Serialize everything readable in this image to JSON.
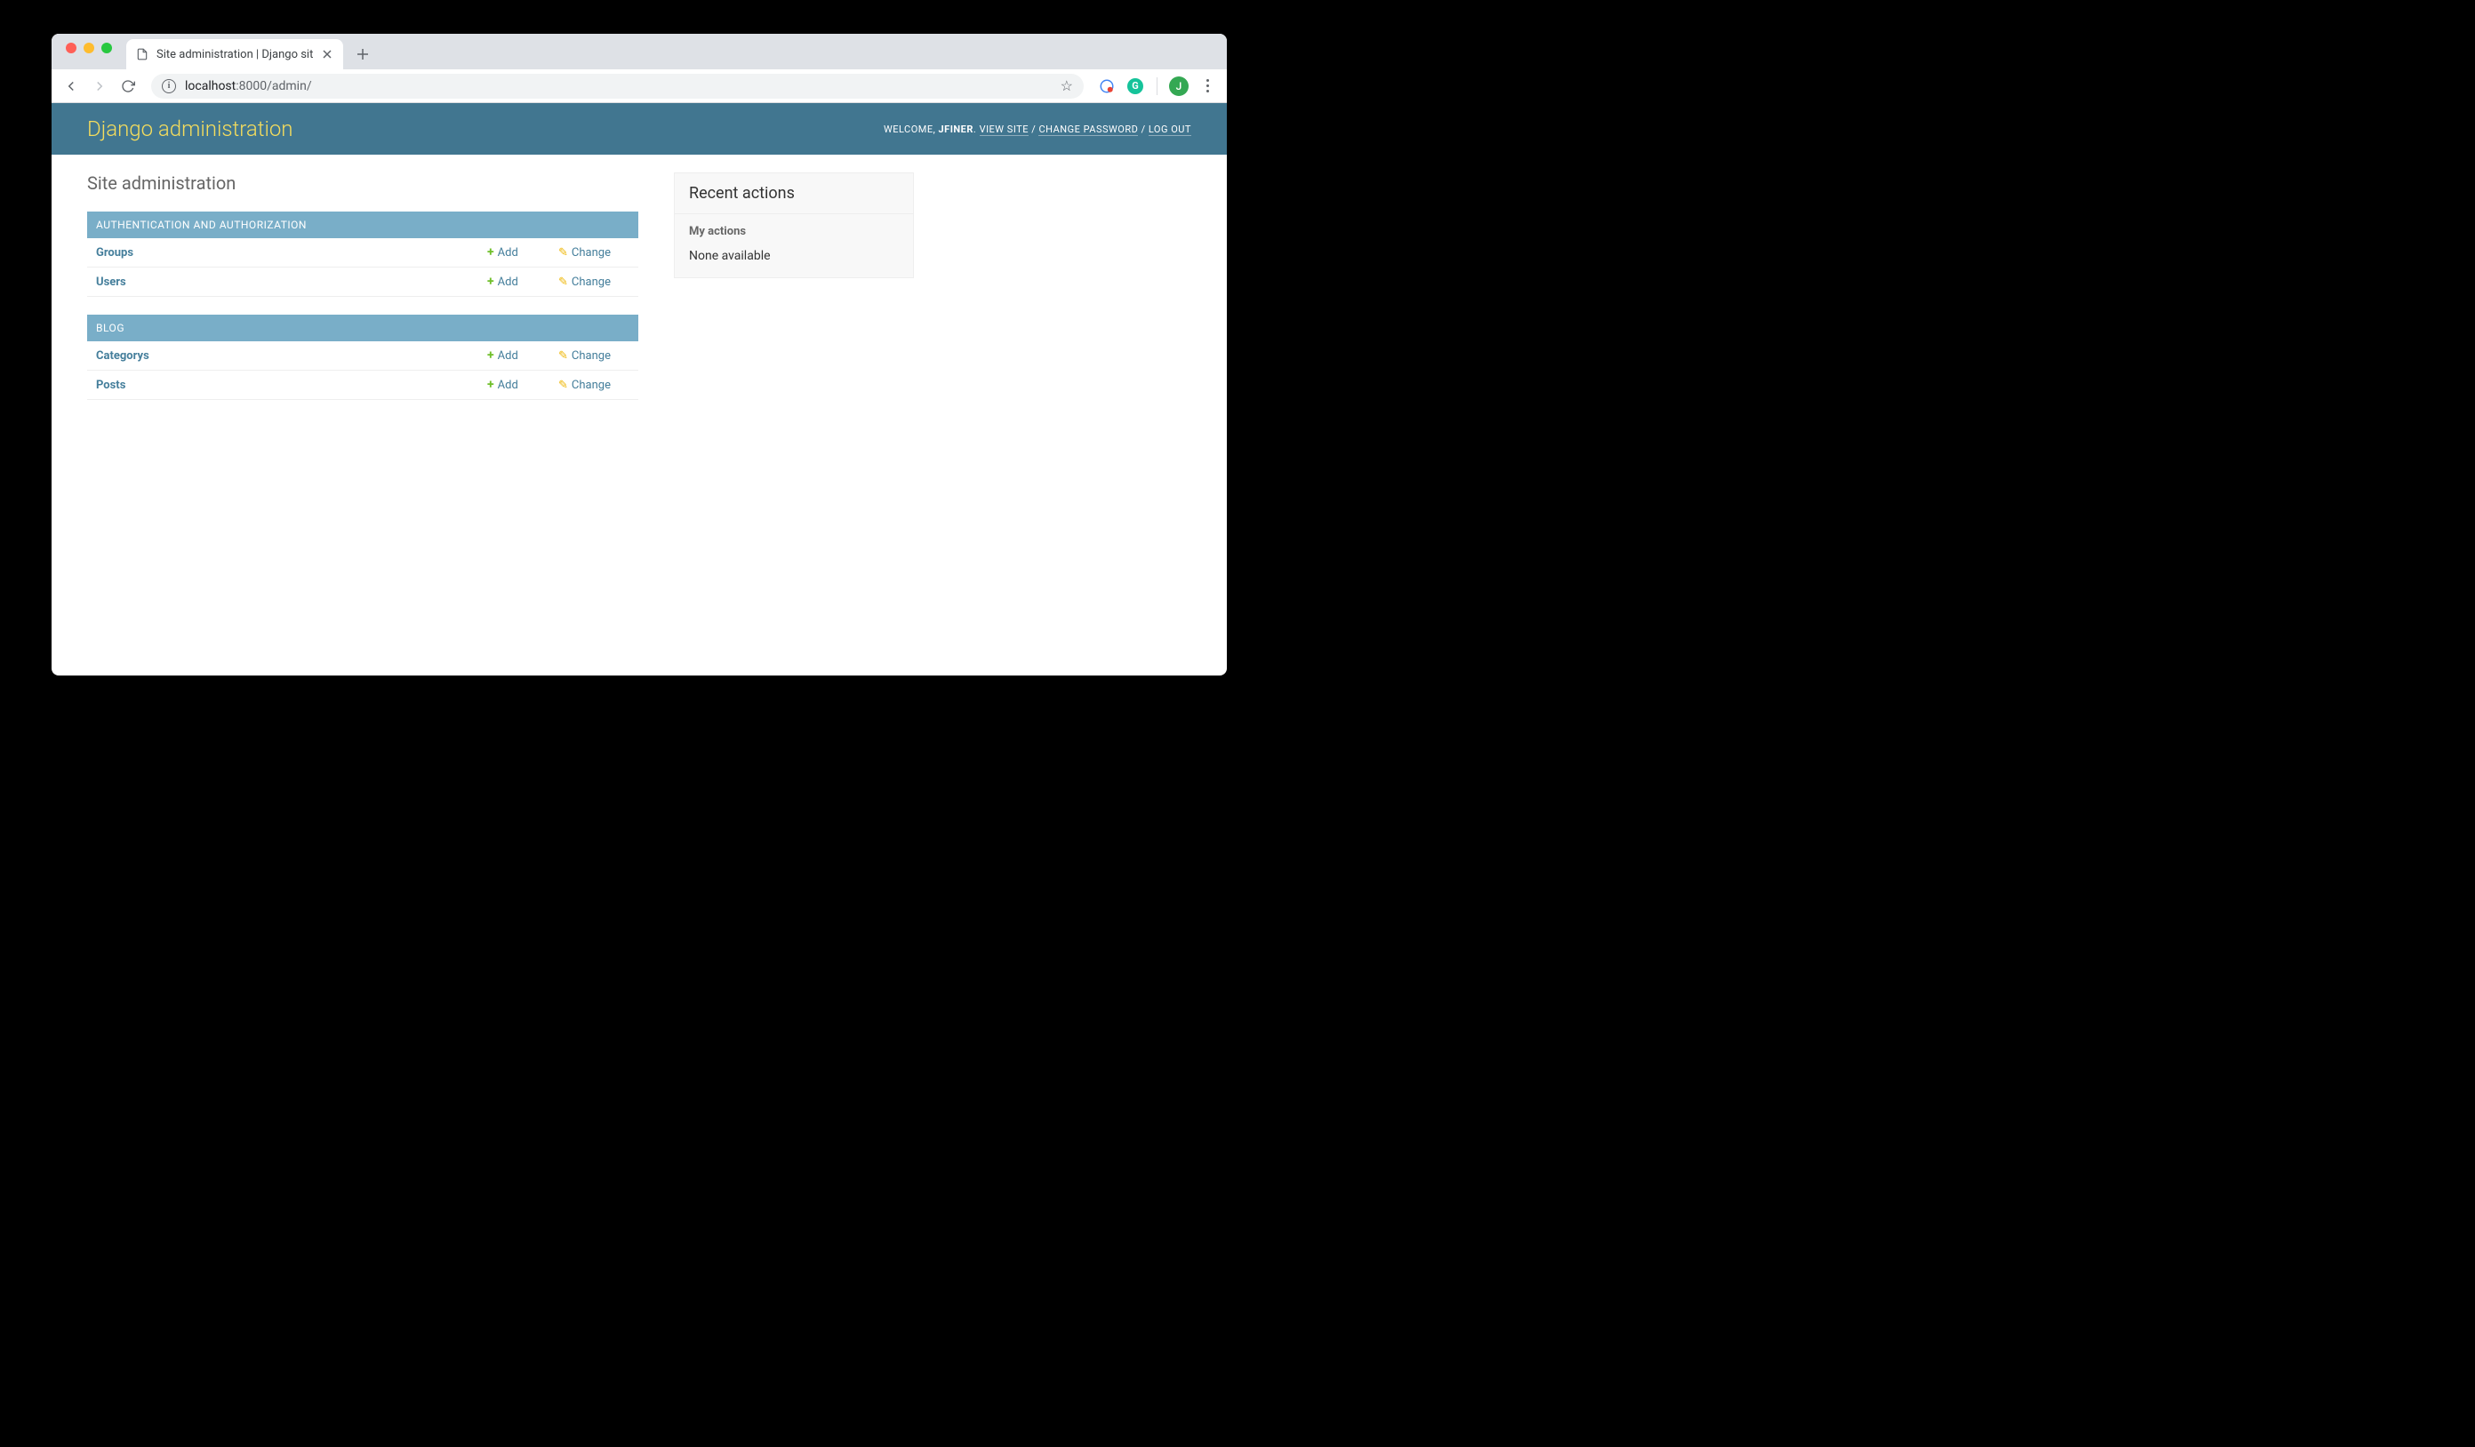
{
  "browser": {
    "tab_title": "Site administration | Django sit",
    "url_host": "localhost",
    "url_port_path": ":8000/admin/",
    "avatar_letter": "J"
  },
  "header": {
    "title": "Django administration",
    "welcome": "WELCOME, ",
    "username": "JFINER",
    "view_site": "VIEW SITE",
    "change_password": "CHANGE PASSWORD",
    "logout": "LOG OUT"
  },
  "page": {
    "heading": "Site administration"
  },
  "apps": [
    {
      "caption": "AUTHENTICATION AND AUTHORIZATION",
      "models": [
        {
          "name": "Groups",
          "add": "Add",
          "change": "Change"
        },
        {
          "name": "Users",
          "add": "Add",
          "change": "Change"
        }
      ]
    },
    {
      "caption": "BLOG",
      "models": [
        {
          "name": "Categorys",
          "add": "Add",
          "change": "Change"
        },
        {
          "name": "Posts",
          "add": "Add",
          "change": "Change"
        }
      ]
    }
  ],
  "recent": {
    "title": "Recent actions",
    "subtitle": "My actions",
    "none": "None available"
  }
}
